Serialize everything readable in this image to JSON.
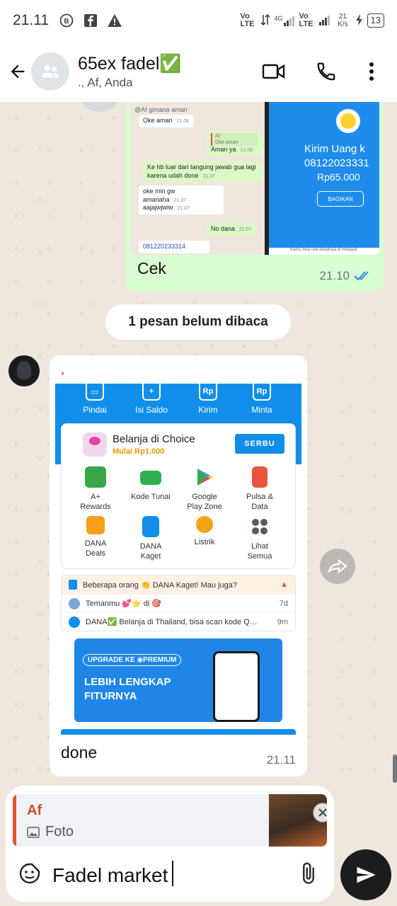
{
  "status_bar": {
    "time": "21.11",
    "net1": "Vo LTE",
    "net2": "4G",
    "net3": "Vo LTE",
    "speed": "21 K/s",
    "battery": "13"
  },
  "header": {
    "title": "65ex fadel✅",
    "subtitle": "., Af, Anda"
  },
  "messages": {
    "outgoing": {
      "screenshot_left": {
        "m1": "@Af gimana aman",
        "m2": "Oke aman",
        "m2_time": "21.06",
        "m3_quote_name": "Af",
        "m3_quote": "Oke aman",
        "m3": "Aman ya",
        "m3_time": "21.06",
        "m4": "Ke hb luar dari tangung jawab gua lagi karena udah done",
        "m4_time": "21.07",
        "m5": "oke min gw amanaha",
        "m5_time": "21.07",
        "m6": "aajajwjwiw",
        "m6_time": "21.07",
        "m7": "No dana",
        "m7_time": "21.07",
        "m8": "081220233314"
      },
      "screenshot_right": {
        "title": "Kirim Uang k",
        "number": "08122023331",
        "amount": "Rp65.000",
        "share": "BAGIKAN",
        "footer": "Kamu bisa cek detailnya di Riwayat"
      },
      "caption": "Cek",
      "time": "21.10"
    },
    "unread_label": "1 pesan belum dibaca",
    "incoming": {
      "quick_actions": [
        "Pindai",
        "Isi Saldo",
        "Kirim",
        "Minta"
      ],
      "promo_title": "Belanja di Choice",
      "promo_sub": "Mulai Rp1.000",
      "promo_btn": "SERBU",
      "services": [
        {
          "label": "A+\nRewards",
          "color": "#3aa64a"
        },
        {
          "label": "Kode Tunai",
          "color": "#2db04f"
        },
        {
          "label": "Google\nPlay Zone",
          "color": "#34a853"
        },
        {
          "label": "Pulsa &\nData",
          "color": "#e8553f"
        },
        {
          "label": "DANA\nDeals",
          "color": "#f59f1a"
        },
        {
          "label": "DANA\nKaget",
          "color": "#118ee9"
        },
        {
          "label": "Listrik",
          "color": "#f2a31a"
        },
        {
          "label": "Lihat\nSemua",
          "color": "#555b66"
        }
      ],
      "notif1": "Beberapa orang 👏 DANA Kaget! Mau juga?",
      "notif2": "Temanmu 💕⭐ di 🎯",
      "notif2_time": "7d",
      "notif3": "DANA✅ Belanja di Thailand, bisa scan kode QR pak...",
      "notif3_time": "9m",
      "banner_tag": "UPGRADE KE ◉PREMIUM",
      "banner_text": "LEBIH LENGKAP FITURNYA",
      "caption": "done",
      "time": "21.11"
    }
  },
  "compose": {
    "reply_name": "Af",
    "reply_type": "Foto",
    "input_value": "Fadel market"
  },
  "colors": {
    "accent": "#1f8ceb",
    "outgoing_bubble": "#d9fdd3",
    "reply_bar": "#e2532f"
  }
}
